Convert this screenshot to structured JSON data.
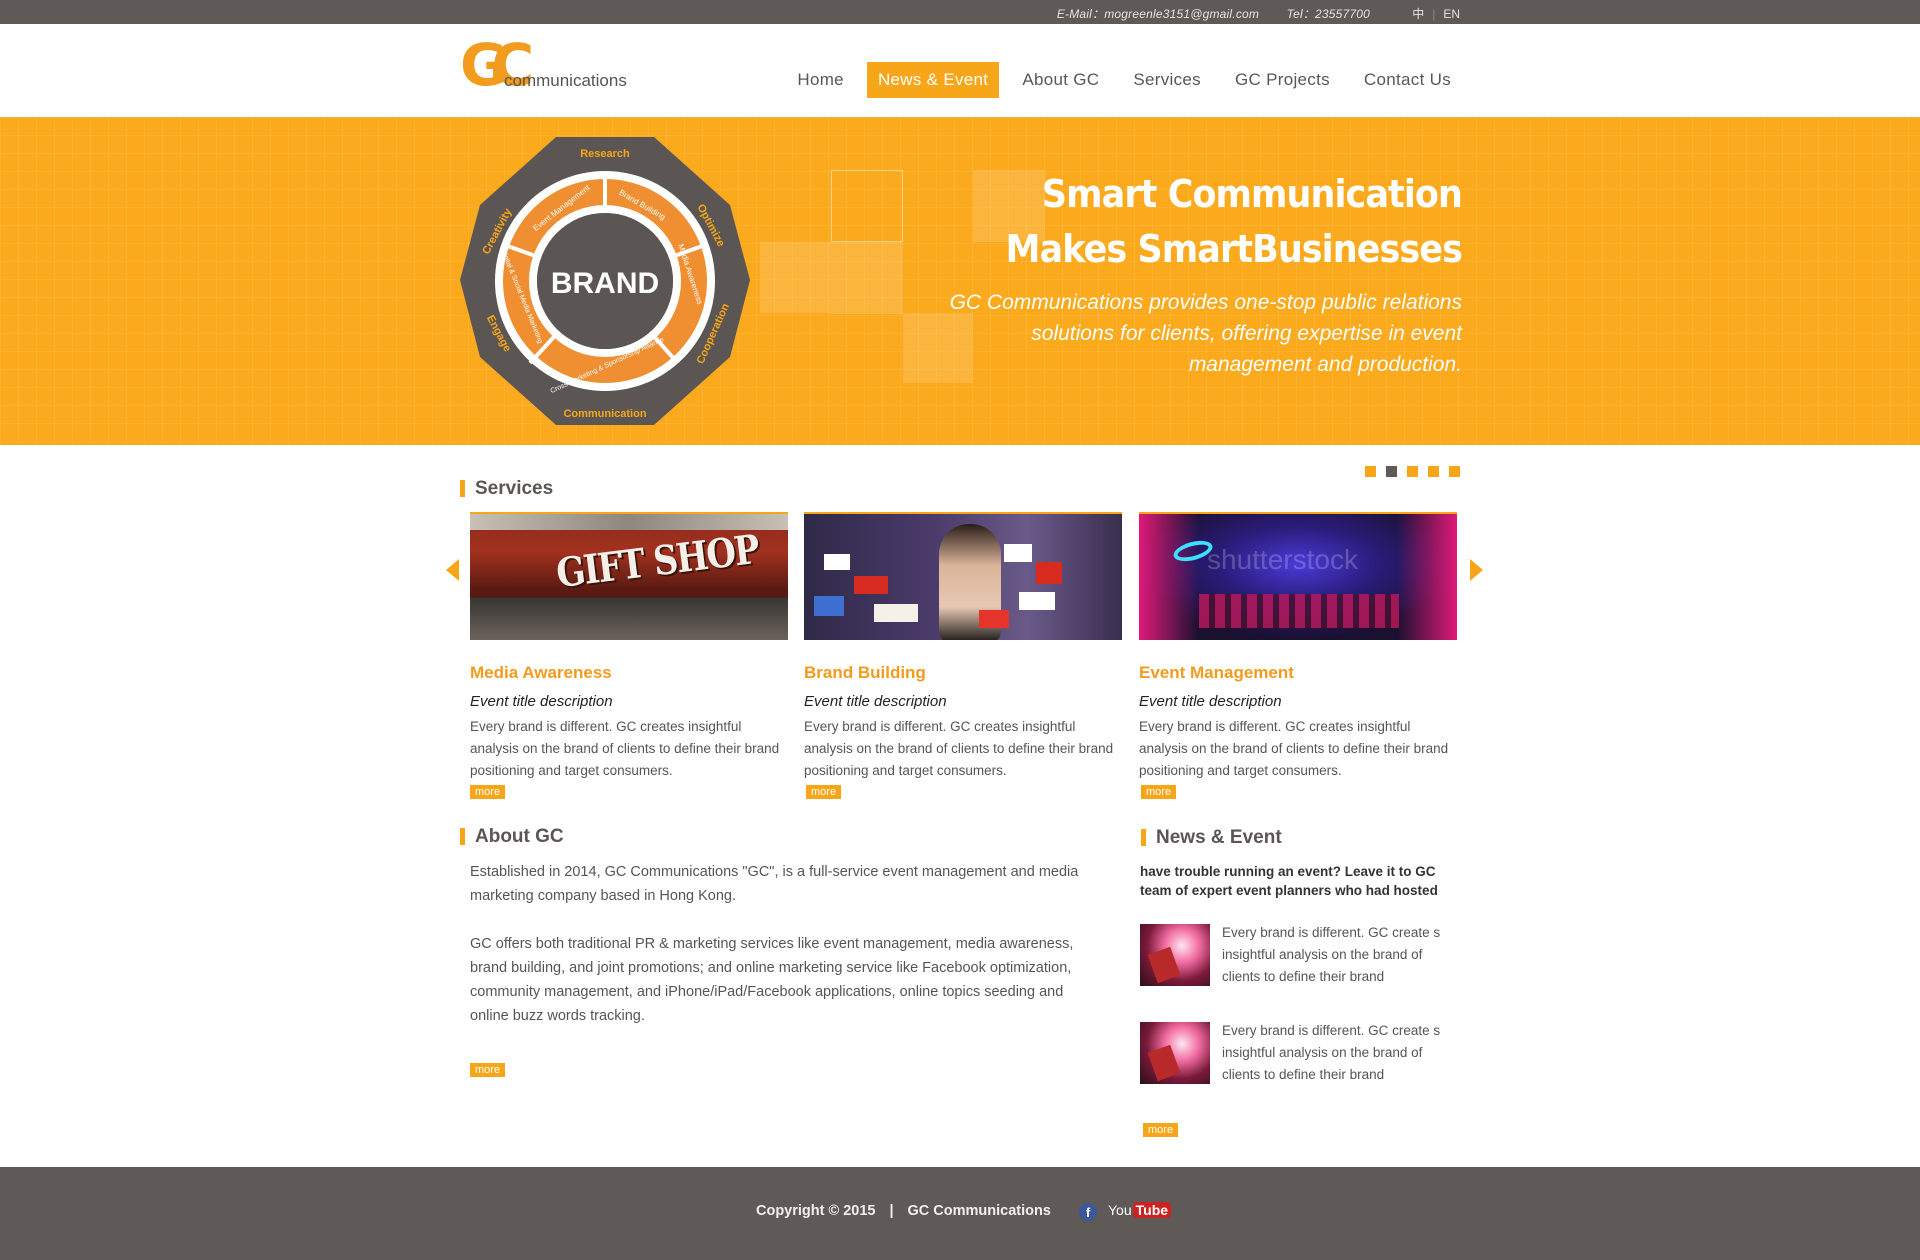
{
  "topbar": {
    "email": "E-Mail：mogreenle3151@gmail.com",
    "tel": "Tel：23557700",
    "lang_zh": "中",
    "lang_en": "EN"
  },
  "brand": {
    "logo_mark": "GC",
    "logo_word": "communications"
  },
  "nav": {
    "home": "Home",
    "news": "News & Event",
    "about": "About GC",
    "services": "Services",
    "projects": "GC Projects",
    "contact": "Contact Us"
  },
  "banner": {
    "badge": {
      "center": "BRAND",
      "top": "Research",
      "bottom": "Communication",
      "left_top": "Creativity",
      "left_bottom": "Engage",
      "right_top": "Optimize",
      "right_bottom": "Cooperation",
      "ring": [
        "Event Management",
        "Brand Building",
        "Media Awareness",
        "Cross Marketing & Sponsorship Alliance",
        "Digital & Social Media Marketing"
      ]
    },
    "headline_1": "Smart Communication",
    "headline_2": "Makes SmartBusinesses",
    "tagline": "GC Communications provides one-stop public relations solutions for clients, offering expertise in event management and production."
  },
  "slider": {
    "total_dots": 5,
    "active_dot": 2
  },
  "services": {
    "title": "Services",
    "cards": [
      {
        "title": "Media Awareness",
        "subtitle": "Event title description",
        "text": "Every brand is different.  GC creates insightful analysis on the brand of clients to define their brand positioning and target consumers.",
        "more": "more",
        "image_sign": "GIFT SHOP"
      },
      {
        "title": "Brand Building",
        "subtitle": "Event title description",
        "text": "Every brand is different.  GC creates insightful analysis on the brand of clients to define their brand positioning and target consumers.",
        "more": "more"
      },
      {
        "title": "Event Management",
        "subtitle": "Event title description",
        "text": "Every brand is different.  GC creates insightful analysis on the brand of clients to define their brand positioning and target consumers.",
        "more": "more",
        "image_watermark": "shutterstock"
      }
    ]
  },
  "about": {
    "title": "About GC",
    "p1": "Established in 2014, GC Communications \"GC\", is a full-service event management and media marketing company based in Hong Kong.",
    "p2": "GC offers both traditional PR & marketing services like event management, media awareness, brand building, and joint promotions; and online marketing service like Facebook optimization, community management, and iPhone/iPad/Facebook applications, online topics seeding and online buzz words tracking.",
    "more": "more"
  },
  "news": {
    "title": "News & Event",
    "lead": "have trouble running an event?  Leave it to GC team of expert event planners who had hosted",
    "items": [
      {
        "text": "Every brand is different.  GC create s insightful analysis on the brand of clients to define their brand"
      },
      {
        "text": "Every brand is different.  GC create s insightful analysis on the brand of clients to define their brand"
      }
    ],
    "more": "more"
  },
  "footer": {
    "copyright": "Copyright © 2015",
    "company": "GC Communications",
    "facebook": "f",
    "youtube_you": "You",
    "youtube_tube": "Tube"
  },
  "colors": {
    "accent": "#f8a619",
    "dark": "#5f5a58",
    "logo": "#f29b1e"
  }
}
